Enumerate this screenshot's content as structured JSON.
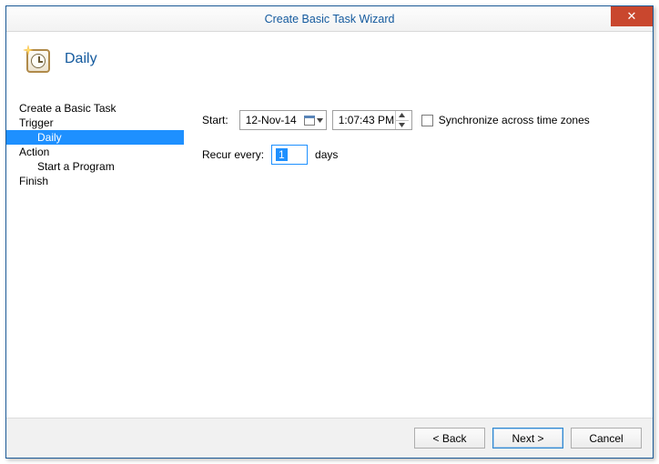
{
  "window": {
    "title": "Create Basic Task Wizard",
    "close_glyph": "✕"
  },
  "header": {
    "title": "Daily"
  },
  "sidebar": {
    "items": [
      {
        "label": "Create a Basic Task",
        "sub": false,
        "selected": false
      },
      {
        "label": "Trigger",
        "sub": false,
        "selected": false
      },
      {
        "label": "Daily",
        "sub": true,
        "selected": true
      },
      {
        "label": "Action",
        "sub": false,
        "selected": false
      },
      {
        "label": "Start a Program",
        "sub": true,
        "selected": false
      },
      {
        "label": "Finish",
        "sub": false,
        "selected": false
      }
    ]
  },
  "form": {
    "start_label": "Start:",
    "date_value": "12-Nov-14",
    "time_value": "1:07:43 PM",
    "sync_label": "Synchronize across time zones",
    "sync_checked": false,
    "recur_label": "Recur every:",
    "recur_value": "1",
    "recur_unit": "days"
  },
  "footer": {
    "back": "< Back",
    "next": "Next >",
    "cancel": "Cancel"
  }
}
